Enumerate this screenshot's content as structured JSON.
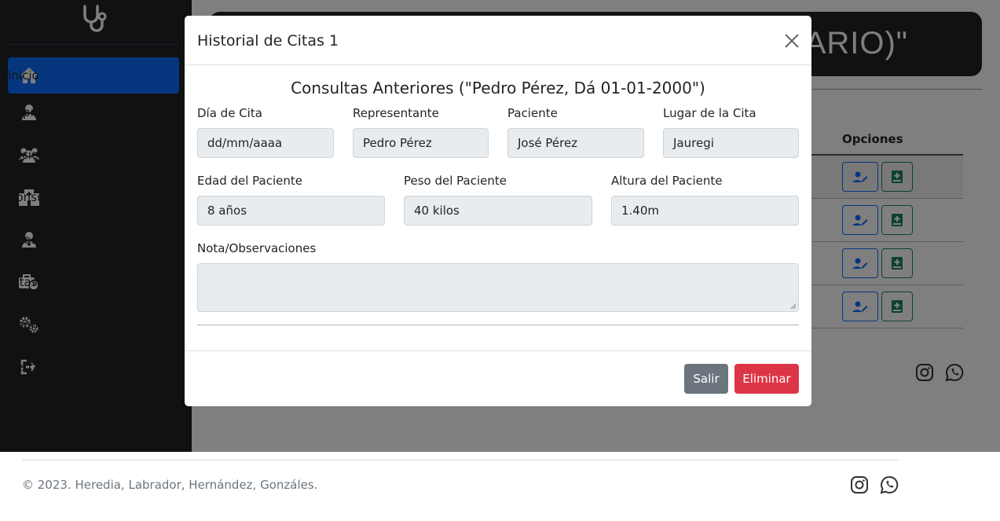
{
  "sidebar": {
    "items": [
      {
        "label": "Inicio",
        "icon": "home-icon",
        "active": true
      },
      {
        "label": "Representantes",
        "icon": "user-icon"
      },
      {
        "label": "Pacientes",
        "icon": "users-icon"
      },
      {
        "label": "Consultorio",
        "icon": "hospital-icon"
      },
      {
        "label": "Citas/Admin",
        "icon": "user-doctor-icon"
      },
      {
        "label": "Citas/Cfg",
        "icon": "briefcase-clock-icon"
      },
      {
        "label": "Configuración",
        "icon": "gears-icon"
      },
      {
        "label": "Cerrar Sesión",
        "icon": "sign-out-icon"
      }
    ]
  },
  "main": {
    "hero_text": "ARIO)\"",
    "table": {
      "opciones_header": "Opciones"
    }
  },
  "modal": {
    "title": "Historial de Citas 1",
    "section_title": "Consultas Anteriores (\"Pedro Pérez, Dá 01-01-2000\")",
    "fields": {
      "dia_label": "Día de Cita",
      "dia_placeholder": "dd/mm/aaaa",
      "representante_label": "Representante",
      "representante_value": "Pedro Pérez",
      "paciente_label": "Paciente",
      "paciente_value": "José Pérez",
      "lugar_label": "Lugar de la Cita",
      "lugar_value": "Jauregi",
      "edad_label": "Edad del Paciente",
      "edad_value": "8 años",
      "peso_label": "Peso del Paciente",
      "peso_value": "40 kilos",
      "altura_label": "Altura del Paciente",
      "altura_value": "1.40m",
      "nota_label": "Nota/Observaciones"
    },
    "buttons": {
      "salir": "Salir",
      "eliminar": "Eliminar"
    }
  },
  "footer": {
    "copyright": "© 2023. Heredia, Labrador, Hernández, Gonzáles."
  },
  "colors": {
    "sidebar_bg": "#1f2226",
    "active_nav": "#0d6efd",
    "salir": "#6c757d",
    "eliminar": "#dc3545"
  }
}
